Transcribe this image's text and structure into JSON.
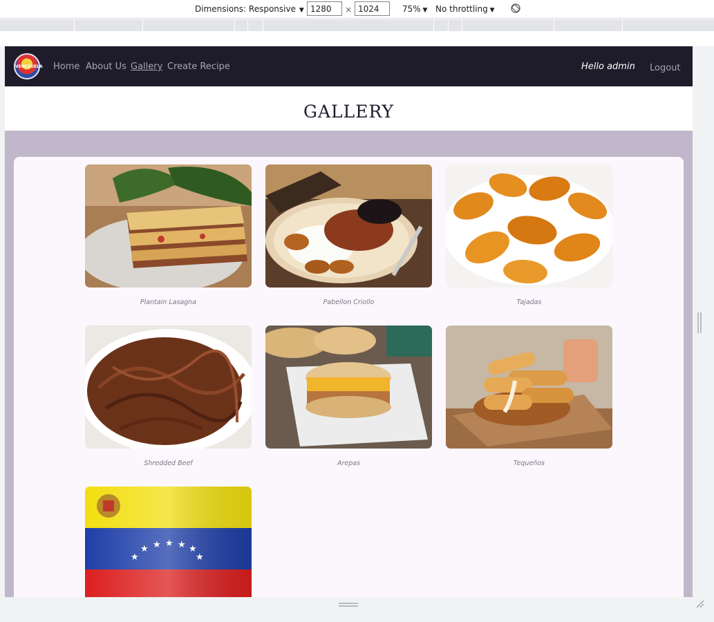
{
  "devtools": {
    "dimensions_label": "Dimensions: Responsive",
    "width_value": "1280",
    "height_value": "1024",
    "times": "×",
    "zoom_label": "75%",
    "throttle_label": "No throttling"
  },
  "navbar": {
    "links": [
      {
        "label": "Home",
        "active": false
      },
      {
        "label": "About Us",
        "active": false
      },
      {
        "label": "Gallery",
        "active": true
      },
      {
        "label": "Create Recipe",
        "active": false
      }
    ],
    "greeting": "Hello admin",
    "logout_label": "Logout",
    "logo_text": "VENEZUELA"
  },
  "page": {
    "title": "GALLERY"
  },
  "gallery": {
    "items": [
      {
        "caption": "Plantain Lasagna",
        "image": "plantain-lasagna-photo"
      },
      {
        "caption": "Pabellon Criollo",
        "image": "pabellon-criollo-photo"
      },
      {
        "caption": "Tajadas",
        "image": "tajadas-photo"
      },
      {
        "caption": "Shredded Beef",
        "image": "shredded-beef-photo"
      },
      {
        "caption": "Arepas",
        "image": "arepas-photo"
      },
      {
        "caption": "Tequeños",
        "image": "tequenos-photo"
      },
      {
        "caption": "",
        "image": "venezuela-flag-photo"
      }
    ]
  },
  "colors": {
    "navbar_bg": "#1e1b2b",
    "page_bg": "#c0b8ca",
    "panel_bg": "#fbf7fd",
    "nav_link": "#a8a4b6"
  }
}
